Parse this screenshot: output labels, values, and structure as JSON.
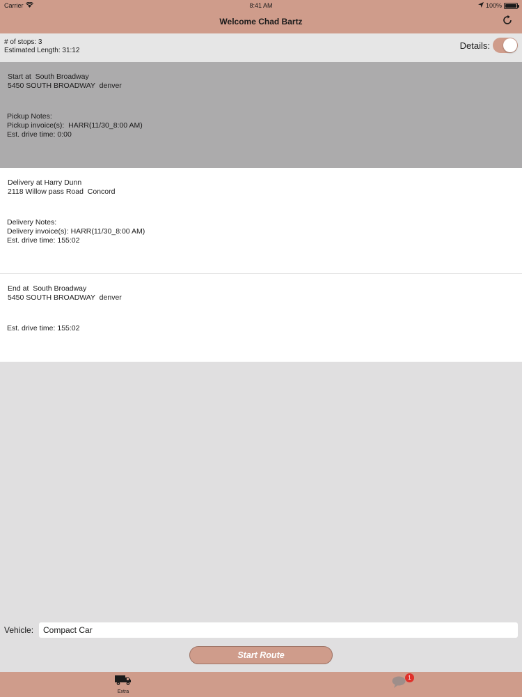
{
  "status_bar": {
    "carrier": "Carrier",
    "time": "8:41 AM",
    "battery": "100%"
  },
  "nav": {
    "title": "Welcome Chad Bartz"
  },
  "summary": {
    "stops": "# of stops: 3",
    "length": "Estimated Length:  31:12",
    "details_label": "Details:",
    "details_on": true
  },
  "stops": [
    {
      "title": "Start at  South Broadway",
      "address": "5450 SOUTH BROADWAY  denver",
      "notes": "Pickup Notes:",
      "invoice": "Pickup invoice(s):  HARR(11/30_8:00 AM)",
      "drive": "Est. drive time: 0:00"
    },
    {
      "title": "Delivery at Harry Dunn",
      "address": "2118 Willow pass Road  Concord",
      "notes": "Delivery Notes:",
      "invoice": "Delivery invoice(s): HARR(11/30_8:00 AM)",
      "drive": "Est. drive time: 155:02"
    },
    {
      "title": "End at  South Broadway",
      "address": "5450 SOUTH BROADWAY  denver",
      "drive": "Est. drive time: 155:02"
    }
  ],
  "vehicle": {
    "label": "Vehicle:",
    "value": "Compact Car"
  },
  "start_button": "Start Route",
  "tabbar": {
    "extra_label": "Extra",
    "chat_badge": "1"
  },
  "colors": {
    "accent": "#cf9c8b",
    "selected_row": "#acabac",
    "badge": "#e0302a"
  }
}
